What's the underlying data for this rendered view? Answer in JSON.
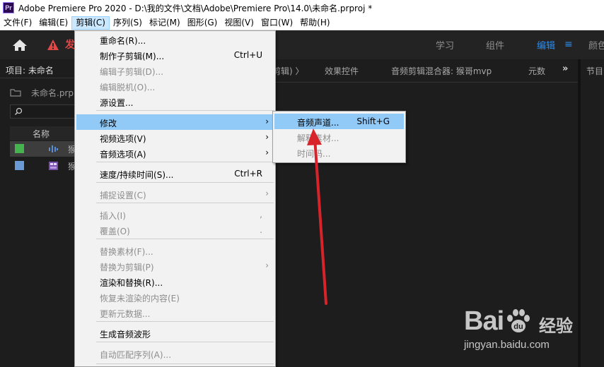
{
  "window": {
    "app_icon_text": "Pr",
    "title": "Adobe Premiere Pro 2020 - D:\\我的文件\\文档\\Adobe\\Premiere Pro\\14.0\\未命名.prproj *"
  },
  "menubar": {
    "items": [
      "文件(F)",
      "编辑(E)",
      "剪辑(C)",
      "序列(S)",
      "标记(M)",
      "图形(G)",
      "视图(V)",
      "窗口(W)",
      "帮助(H)"
    ],
    "active_index": 2
  },
  "header": {
    "warning_text": "发",
    "workspaces": {
      "learn": "学习",
      "assembly": "组件",
      "editing": "编辑",
      "color": "颜色"
    },
    "active_workspace": "编辑",
    "accent_color": "#2d8ceb",
    "warning_color": "#e04848"
  },
  "project_panel": {
    "tab_title": "项目: 未命名",
    "bin_name": "未命名.prpr",
    "column_name": "名称",
    "rows": [
      {
        "label": "猴",
        "swatch_color": "#45b34e",
        "icon": "audio-clip-icon"
      },
      {
        "label": "猴",
        "swatch_color": "#6a9ad6",
        "icon": "sequence-icon"
      }
    ]
  },
  "center_panel": {
    "tabs": [
      "剪辑) 〉",
      "效果控件",
      "音频剪辑混合器: 猴哥mvp",
      "元数",
      "»"
    ],
    "program_tab": "节目"
  },
  "clip_menu": {
    "items": [
      {
        "label": "重命名(R)...",
        "shortcut": "",
        "disabled": false,
        "submenu": false
      },
      {
        "label": "制作子剪辑(M)...",
        "shortcut": "Ctrl+U",
        "disabled": false,
        "submenu": false
      },
      {
        "label": "编辑子剪辑(D)...",
        "shortcut": "",
        "disabled": true,
        "submenu": false
      },
      {
        "label": "编辑脱机(O)...",
        "shortcut": "",
        "disabled": true,
        "submenu": false
      },
      {
        "label": "源设置...",
        "shortcut": "",
        "disabled": false,
        "submenu": false
      },
      {
        "label": "修改",
        "shortcut": "",
        "disabled": false,
        "submenu": true,
        "highlighted": true
      },
      {
        "label": "视频选项(V)",
        "shortcut": "",
        "disabled": false,
        "submenu": true
      },
      {
        "label": "音频选项(A)",
        "shortcut": "",
        "disabled": false,
        "submenu": true
      },
      {
        "label": "速度/持续时间(S)...",
        "shortcut": "Ctrl+R",
        "disabled": false,
        "submenu": false
      },
      {
        "label": "捕捉设置(C)",
        "shortcut": "",
        "disabled": true,
        "submenu": true
      },
      {
        "label": "插入(I)",
        "shortcut": ",",
        "disabled": true,
        "submenu": false
      },
      {
        "label": "覆盖(O)",
        "shortcut": ".",
        "disabled": true,
        "submenu": false
      },
      {
        "label": "替换素材(F)...",
        "shortcut": "",
        "disabled": true,
        "submenu": false
      },
      {
        "label": "替换为剪辑(P)",
        "shortcut": "",
        "disabled": true,
        "submenu": true
      },
      {
        "label": "渲染和替换(R)...",
        "shortcut": "",
        "disabled": false,
        "submenu": false
      },
      {
        "label": "恢复未渲染的内容(E)",
        "shortcut": "",
        "disabled": true,
        "submenu": false
      },
      {
        "label": "更新元数据...",
        "shortcut": "",
        "disabled": true,
        "submenu": false
      },
      {
        "label": "生成音频波形",
        "shortcut": "",
        "disabled": false,
        "submenu": false
      },
      {
        "label": "自动匹配序列(A)...",
        "shortcut": "",
        "disabled": true,
        "submenu": false
      }
    ]
  },
  "modify_submenu": {
    "items": [
      {
        "label": "音频声道...",
        "shortcut": "Shift+G",
        "disabled": false,
        "highlighted": true
      },
      {
        "label": "解释素材...",
        "shortcut": "",
        "disabled": true
      },
      {
        "label": "时间码...",
        "shortcut": "",
        "disabled": true
      }
    ]
  },
  "annotation": {
    "color": "#d9232a"
  },
  "watermark": {
    "logo_text": "Bai",
    "product_text": "经验",
    "url": "jingyan.baidu.com"
  }
}
